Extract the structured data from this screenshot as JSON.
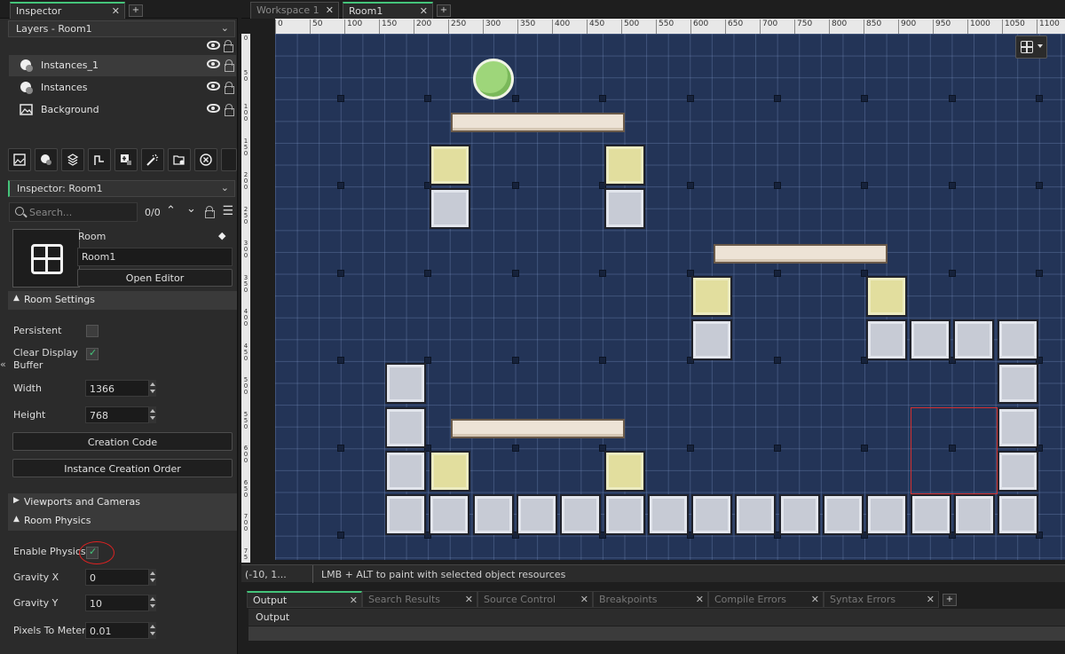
{
  "left_panel": {
    "tab": {
      "label": "Inspector"
    },
    "layers_header": "Layers - Room1",
    "layers": [
      {
        "name": "Instances_1",
        "selected": true
      },
      {
        "name": "Instances",
        "selected": false
      },
      {
        "name": "Background",
        "selected": false
      }
    ],
    "inspector_header": "Inspector: Room1",
    "search": {
      "placeholder": "Search...",
      "count": "0/0"
    },
    "room": {
      "type_label": "Room",
      "name": "Room1",
      "open_editor": "Open Editor"
    },
    "room_settings": {
      "title": "Room Settings",
      "persistent_label": "Persistent",
      "clear_display_label": "Clear Display Buffer",
      "width_label": "Width",
      "width_value": "1366",
      "height_label": "Height",
      "height_value": "768",
      "creation_code": "Creation Code",
      "instance_creation_order": "Instance Creation Order"
    },
    "viewports_title": "Viewports and Cameras",
    "physics": {
      "title": "Room Physics",
      "enable_label": "Enable Physics",
      "gravity_x_label": "Gravity X",
      "gravity_x_value": "0",
      "gravity_y_label": "Gravity Y",
      "gravity_y_value": "10",
      "pixels_to_meters_label": "Pixels To Meters",
      "pixels_to_meters_value": "0.01"
    }
  },
  "editor": {
    "tabs": [
      {
        "label": "Workspace 1",
        "active": false
      },
      {
        "label": "Room1",
        "active": true
      }
    ],
    "ruler_top": [
      "0",
      "50",
      "100",
      "150",
      "200",
      "250",
      "300",
      "350",
      "400",
      "450",
      "500",
      "550",
      "600",
      "650",
      "700",
      "750",
      "800",
      "850",
      "900",
      "950",
      "1000",
      "1050",
      "1100"
    ],
    "ruler_left": [
      "0",
      "5 0",
      "1 0 0",
      "1 5 0",
      "2 0 0",
      "2 5 0",
      "3 0 0",
      "3 5 0",
      "4 0 0",
      "4 5 0",
      "5 0 0",
      "5 5 0",
      "6 0 0",
      "6 5 0",
      "7 0 0",
      "7 5"
    ],
    "status": {
      "coords": "(-10, 1...",
      "hint": "LMB + ALT to paint with selected object resources"
    },
    "output_tabs": [
      "Output",
      "Search Results",
      "Source Control",
      "Breakpoints",
      "Compile Errors",
      "Syntax Errors"
    ],
    "output_title": "Output"
  }
}
